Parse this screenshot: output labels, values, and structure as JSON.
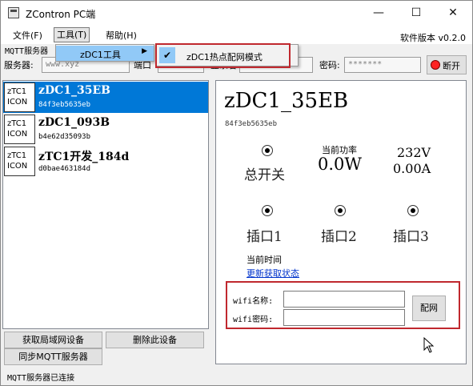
{
  "window": {
    "title": "ZContron PC端",
    "minimize": "—",
    "maximize": "☐",
    "close": "✕"
  },
  "menu": {
    "file": "文件(F)",
    "tools": "工具(T)",
    "help": "帮助(H)",
    "version": "软件版本 v0.2.0"
  },
  "dropdown": {
    "item": "zDC1工具",
    "arrow": "▶",
    "submenu_item": "zDC1热点配网模式",
    "check": "✔"
  },
  "mqtt": {
    "section_label": "MQTT服务器",
    "server_label": "服务器:",
    "server_value": "www.xyz",
    "port_label": "端口",
    "user_label": "登录名",
    "password_label": "密码:",
    "password_value": "*******",
    "disconnect_label": "断开"
  },
  "devices": [
    {
      "icon": "zTC1\nICON",
      "name": "zDC1_35EB",
      "mac": "84f3eb5635eb",
      "selected": true
    },
    {
      "icon": "zTC1\nICON",
      "name": "zDC1_093B",
      "mac": "b4e62d35093b",
      "selected": false
    },
    {
      "icon": "zTC1\nICON",
      "name": "zTC1开发_184d",
      "mac": "d0bae463184d",
      "selected": false
    }
  ],
  "buttons": {
    "scan_lan": "获取局域网设备",
    "delete_device": "删除此设备",
    "sync_mqtt": "同步MQTT服务器"
  },
  "detail": {
    "name": "zDC1_35EB",
    "mac": "84f3eb5635eb",
    "main_switch": "总开关",
    "power_label": "当前功率",
    "power_value": "0.0W",
    "voltage_value": "232V",
    "current_value": "0.00A",
    "socket1": "插口1",
    "socket2": "插口2",
    "socket3": "插口3",
    "time_label": "当前时间",
    "refresh_link": "更新获取状态",
    "wifi_name_label": "wifi名称:",
    "wifi_pwd_label": "wifi密码:",
    "config_button": "配网"
  },
  "status": {
    "text": "MQTT服务器已连接"
  },
  "colors": {
    "selection": "#0078d7",
    "highlight_border": "#c0282e",
    "menu_hover": "#91c9f7",
    "disconnect_dot": "#ff2222"
  }
}
